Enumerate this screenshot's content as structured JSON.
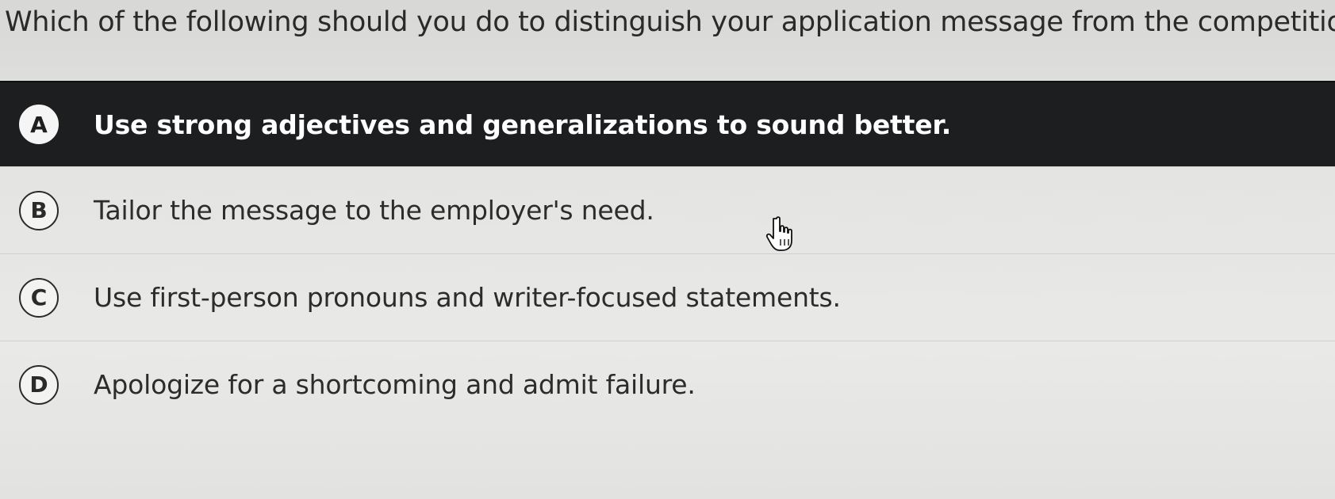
{
  "question": {
    "text": "Which of the following should you do to distinguish your application message from the competition?"
  },
  "options": [
    {
      "letter": "A",
      "text": "Use strong adjectives and generalizations to sound better.",
      "selected": true
    },
    {
      "letter": "B",
      "text": "Tailor the message to the employer's need.",
      "selected": false
    },
    {
      "letter": "C",
      "text": "Use first-person pronouns and writer-focused statements.",
      "selected": false
    },
    {
      "letter": "D",
      "text": "Apologize for a shortcoming and admit failure.",
      "selected": false
    }
  ],
  "colors": {
    "selected_background": "#1d1e20",
    "page_background": "#e4e4e2"
  },
  "icons": {
    "pointer": "hand-pointer-icon"
  }
}
